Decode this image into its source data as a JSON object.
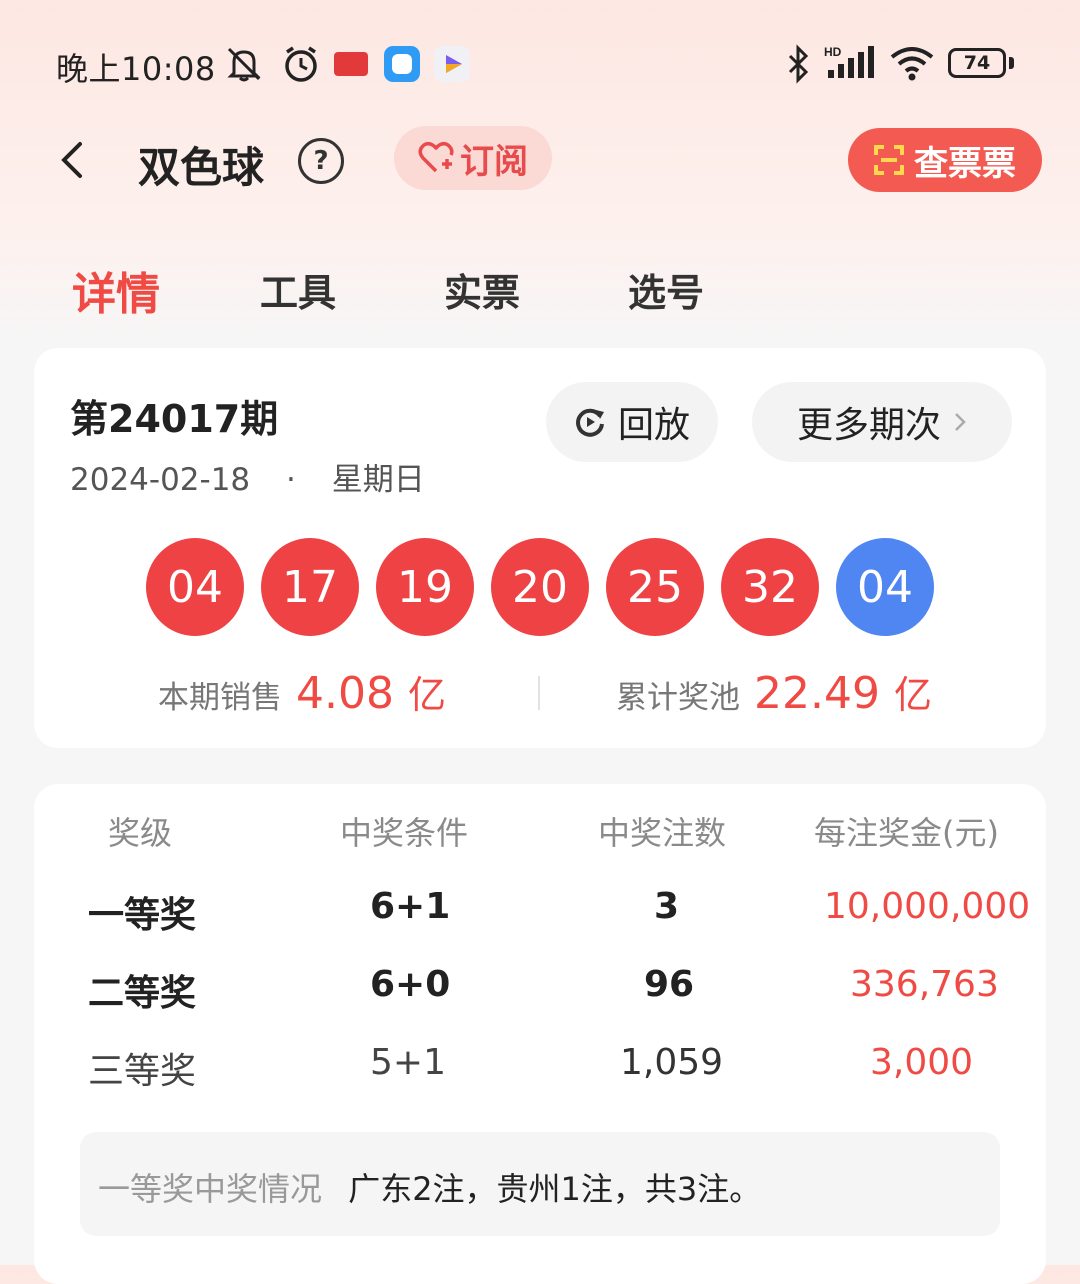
{
  "status_bar": {
    "time": "晚上10:08",
    "app_icons": [
      "mute-bell-icon",
      "alarm-icon",
      "toutiao-app-icon",
      "blue-app-icon",
      "video-app-icon"
    ],
    "system_icons": [
      "bluetooth-icon",
      "hd-signal-icon",
      "wifi-icon"
    ],
    "battery": "74"
  },
  "header": {
    "title": "双色球",
    "help": "?",
    "subscribe_label": "订阅",
    "check_ticket_label": "查票票"
  },
  "tabs": [
    {
      "label": "详情",
      "active": true
    },
    {
      "label": "工具",
      "active": false
    },
    {
      "label": "实票",
      "active": false
    },
    {
      "label": "选号",
      "active": false
    }
  ],
  "draw": {
    "issue": "第24017期",
    "date": "2024-02-18",
    "dot": "·",
    "weekday": "星期日",
    "replay_label": "回放",
    "more_label": "更多期次",
    "red_balls": [
      "04",
      "17",
      "19",
      "20",
      "25",
      "32"
    ],
    "blue_ball": "04",
    "sales_label": "本期销售",
    "sales_value": "4.08",
    "sales_unit": "亿",
    "pool_label": "累计奖池",
    "pool_value": "22.49",
    "pool_unit": "亿"
  },
  "prize_table": {
    "headers": [
      "奖级",
      "中奖条件",
      "中奖注数",
      "每注奖金(元)"
    ],
    "rows": [
      {
        "level": "一等奖",
        "condition": "6+1",
        "count": "3",
        "amount": "10,000,000"
      },
      {
        "level": "二等奖",
        "condition": "6+0",
        "count": "96",
        "amount": "336,763"
      },
      {
        "level": "三等奖",
        "condition": "5+1",
        "count": "1,059",
        "amount": "3,000"
      }
    ],
    "note_label": "一等奖中奖情况",
    "note_text": "广东2注，贵州1注，共3注。"
  },
  "colors": {
    "accent_red": "#ef4a44",
    "ball_red": "#ee4244",
    "ball_blue": "#4f86f2"
  }
}
